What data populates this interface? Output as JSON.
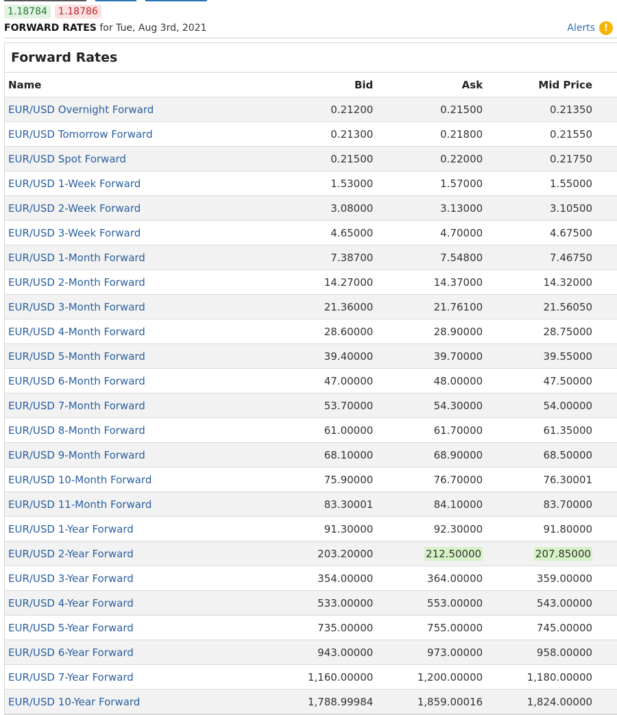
{
  "quotes": {
    "bid": "1.18784",
    "ask": "1.18786"
  },
  "subheader": {
    "title_bold": "FORWARD RATES",
    "title_rest": " for Tue, Aug 3rd, 2021",
    "alerts_label": "Alerts",
    "alerts_icon": "!"
  },
  "panel": {
    "title": "Forward Rates"
  },
  "table": {
    "headers": {
      "name": "Name",
      "bid": "Bid",
      "ask": "Ask",
      "mid": "Mid Price"
    },
    "rows": [
      {
        "name": "EUR/USD Overnight Forward",
        "bid": "0.21200",
        "ask": "0.21500",
        "mid": "0.21350"
      },
      {
        "name": "EUR/USD Tomorrow Forward",
        "bid": "0.21300",
        "ask": "0.21800",
        "mid": "0.21550"
      },
      {
        "name": "EUR/USD Spot Forward",
        "bid": "0.21500",
        "ask": "0.22000",
        "mid": "0.21750"
      },
      {
        "name": "EUR/USD 1-Week Forward",
        "bid": "1.53000",
        "ask": "1.57000",
        "mid": "1.55000"
      },
      {
        "name": "EUR/USD 2-Week Forward",
        "bid": "3.08000",
        "ask": "3.13000",
        "mid": "3.10500"
      },
      {
        "name": "EUR/USD 3-Week Forward",
        "bid": "4.65000",
        "ask": "4.70000",
        "mid": "4.67500"
      },
      {
        "name": "EUR/USD 1-Month Forward",
        "bid": "7.38700",
        "ask": "7.54800",
        "mid": "7.46750"
      },
      {
        "name": "EUR/USD 2-Month Forward",
        "bid": "14.27000",
        "ask": "14.37000",
        "mid": "14.32000"
      },
      {
        "name": "EUR/USD 3-Month Forward",
        "bid": "21.36000",
        "ask": "21.76100",
        "mid": "21.56050"
      },
      {
        "name": "EUR/USD 4-Month Forward",
        "bid": "28.60000",
        "ask": "28.90000",
        "mid": "28.75000"
      },
      {
        "name": "EUR/USD 5-Month Forward",
        "bid": "39.40000",
        "ask": "39.70000",
        "mid": "39.55000"
      },
      {
        "name": "EUR/USD 6-Month Forward",
        "bid": "47.00000",
        "ask": "48.00000",
        "mid": "47.50000"
      },
      {
        "name": "EUR/USD 7-Month Forward",
        "bid": "53.70000",
        "ask": "54.30000",
        "mid": "54.00000"
      },
      {
        "name": "EUR/USD 8-Month Forward",
        "bid": "61.00000",
        "ask": "61.70000",
        "mid": "61.35000"
      },
      {
        "name": "EUR/USD 9-Month Forward",
        "bid": "68.10000",
        "ask": "68.90000",
        "mid": "68.50000"
      },
      {
        "name": "EUR/USD 10-Month Forward",
        "bid": "75.90000",
        "ask": "76.70000",
        "mid": "76.30001"
      },
      {
        "name": "EUR/USD 11-Month Forward",
        "bid": "83.30001",
        "ask": "84.10000",
        "mid": "83.70000"
      },
      {
        "name": "EUR/USD 1-Year Forward",
        "bid": "91.30000",
        "ask": "92.30000",
        "mid": "91.80000"
      },
      {
        "name": "EUR/USD 2-Year Forward",
        "bid": "203.20000",
        "ask": "212.50000",
        "mid": "207.85000",
        "highlight": [
          "ask",
          "mid"
        ]
      },
      {
        "name": "EUR/USD 3-Year Forward",
        "bid": "354.00000",
        "ask": "364.00000",
        "mid": "359.00000"
      },
      {
        "name": "EUR/USD 4-Year Forward",
        "bid": "533.00000",
        "ask": "553.00000",
        "mid": "543.00000"
      },
      {
        "name": "EUR/USD 5-Year Forward",
        "bid": "735.00000",
        "ask": "755.00000",
        "mid": "745.00000"
      },
      {
        "name": "EUR/USD 6-Year Forward",
        "bid": "943.00000",
        "ask": "973.00000",
        "mid": "958.00000"
      },
      {
        "name": "EUR/USD 7-Year Forward",
        "bid": "1,160.00000",
        "ask": "1,200.00000",
        "mid": "1,180.00000"
      },
      {
        "name": "EUR/USD 10-Year Forward",
        "bid": "1,788.99984",
        "ask": "1,859.00016",
        "mid": "1,824.00000"
      }
    ]
  },
  "colors": {
    "bid_quote": "#1f7a33",
    "ask_quote": "#c0272d",
    "link": "#2a5f9e",
    "highlight": "#d6f2c6",
    "alert": "#f5b400"
  }
}
